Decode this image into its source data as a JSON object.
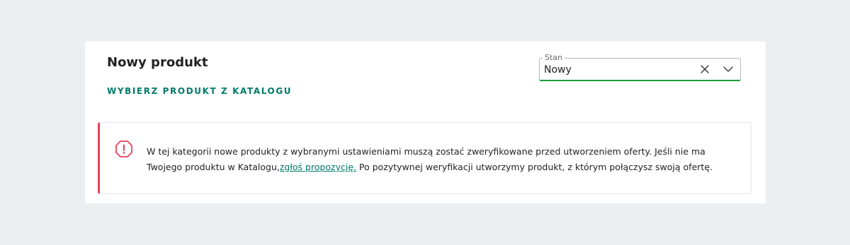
{
  "product": {
    "title": "Nowy produkt",
    "catalog_link": "WYBIERZ PRODUKT Z KATALOGU"
  },
  "condition_select": {
    "label": "Stan",
    "value": "Nowy",
    "clear_icon": "close-icon",
    "dropdown_icon": "chevron-down-icon"
  },
  "alert": {
    "icon": "warning-octagon-icon",
    "text_part1": "W tej kategorii nowe produkty z wybranymi ustawieniami muszą zostać zweryfikowane przed utworzeniem oferty. Jeśli nie ma Twojego produktu w Katalogu,",
    "link_text": "zgłoś propozycję.",
    "text_part2": " Po pozytywnej weryfikacji utworzymy produkt, z którym połączysz swoją ofertę."
  },
  "colors": {
    "accent_teal": "#007a6b",
    "alert_red": "#e6405b",
    "focus_green": "#1a9a3a",
    "page_bg": "#eceff2"
  }
}
